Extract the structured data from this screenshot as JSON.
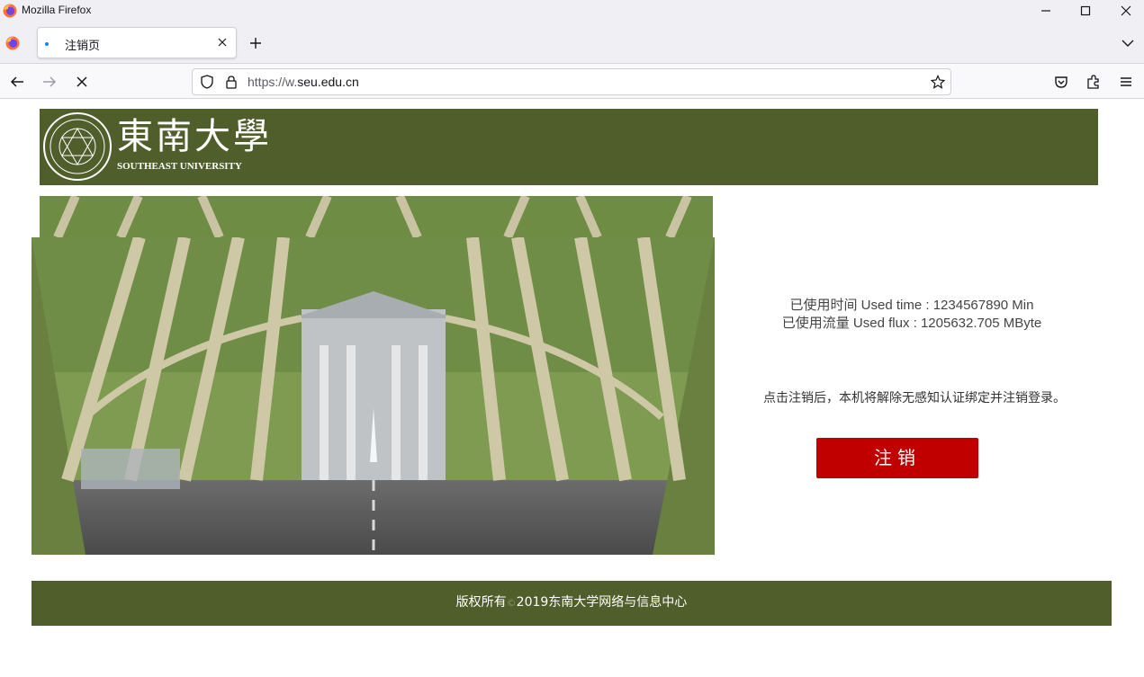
{
  "window": {
    "title": "Mozilla Firefox",
    "controls": {
      "minimize": "minimize-icon",
      "maximize": "maximize-icon",
      "close": "close-icon"
    }
  },
  "tabs": [
    {
      "label": "注销页",
      "active": true,
      "loading": true
    }
  ],
  "navbar": {
    "url_prefix": "https://w.",
    "url_domain": "seu.edu.cn"
  },
  "header": {
    "logo_cn": "東南大學",
    "logo_en": "SOUTHEAST UNIVERSITY",
    "band_color": "#4f5e2a"
  },
  "info": {
    "used_time_label": "已使用时间 Used time : ",
    "used_time_value": "1234567890",
    "used_time_unit": " Min",
    "used_flux_label": "已使用流量 Used flux : ",
    "used_flux_value": "1205632.705",
    "used_flux_unit": " MByte"
  },
  "notice": "点击注销后，本机将解除无感知认证绑定并注销登录。",
  "logout_button": {
    "label": "注销",
    "color": "#c00000"
  },
  "footer": {
    "prefix": "版权所有",
    "symbol": "©",
    "suffix": "2019东南大学网络与信息中心"
  }
}
